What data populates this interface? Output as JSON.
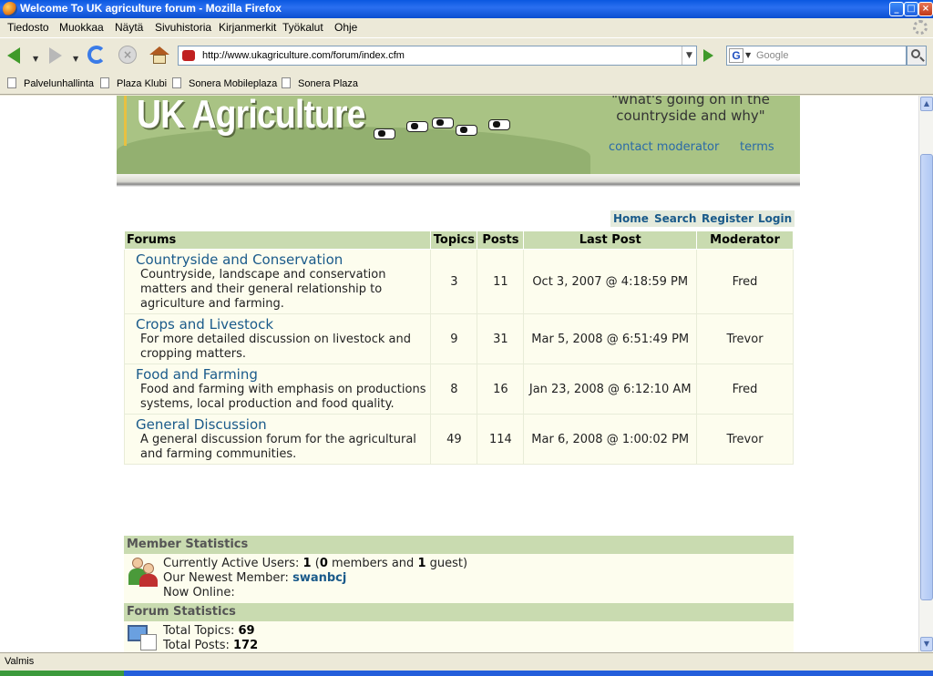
{
  "window": {
    "title": "Welcome To UK agriculture forum - Mozilla Firefox",
    "controls": [
      "minimize",
      "maximize",
      "close"
    ]
  },
  "menu": [
    "Tiedosto",
    "Muokkaa",
    "Näytä",
    "Sivuhistoria",
    "Kirjanmerkit",
    "Työkalut",
    "Ohje"
  ],
  "toolbar": {
    "url": "http://www.ukagriculture.com/forum/index.cfm",
    "search_placeholder": "Google",
    "search_engine_letter": "G"
  },
  "bookmarks": [
    "Palvelunhallinta",
    "Plaza Klubi",
    "Sonera Mobileplaza",
    "Sonera Plaza"
  ],
  "banner": {
    "logo": "UK Agriculture",
    "tagline": "\"what's going on in the countryside and why\"",
    "contact_link": "contact moderator",
    "terms_link": "terms"
  },
  "nav_links": [
    "Home",
    "Search",
    "Register",
    "Login"
  ],
  "forum_table": {
    "headers": [
      "Forums",
      "Topics",
      "Posts",
      "Last Post",
      "Moderator"
    ],
    "rows": [
      {
        "name": "Countryside and Conservation",
        "description": "Countryside, landscape and conservation matters and their general relationship to agriculture and farming.",
        "topics": "3",
        "posts": "11",
        "last_post": "Oct 3, 2007 @ 4:18:59 PM",
        "moderator": "Fred"
      },
      {
        "name": "Crops and Livestock",
        "description": "For more detailed discussion on livestock and cropping matters.",
        "topics": "9",
        "posts": "31",
        "last_post": "Mar 5, 2008 @ 6:51:49 PM",
        "moderator": "Trevor"
      },
      {
        "name": "Food and Farming",
        "description": "Food and farming with emphasis on productions systems, local production and food quality.",
        "topics": "8",
        "posts": "16",
        "last_post": "Jan 23, 2008 @ 6:12:10 AM",
        "moderator": "Fred"
      },
      {
        "name": "General Discussion",
        "description": "A general discussion forum for the agricultural and farming communities.",
        "topics": "49",
        "posts": "114",
        "last_post": "Mar 6, 2008 @ 1:00:02 PM",
        "moderator": "Trevor"
      }
    ]
  },
  "member_stats": {
    "heading": "Member Statistics",
    "active_label": "Currently Active Users:",
    "active_total": "1",
    "active_members": "0",
    "members_word": "members and",
    "active_guests": "1",
    "guest_word": "guest)",
    "newest_label": "Our Newest Member:",
    "newest_member": "swanbcj",
    "online_label": "Now Online:"
  },
  "forum_stats": {
    "heading": "Forum Statistics",
    "topics_label": "Total Topics:",
    "topics_value": "69",
    "posts_label": "Total Posts:",
    "posts_value": "172"
  },
  "statusbar": {
    "text": "Valmis"
  },
  "colors": {
    "header_green": "#c9dbb0",
    "row_bg": "#fdfdee",
    "link_blue": "#1a5a8a",
    "banner_green": "#a9c384"
  }
}
